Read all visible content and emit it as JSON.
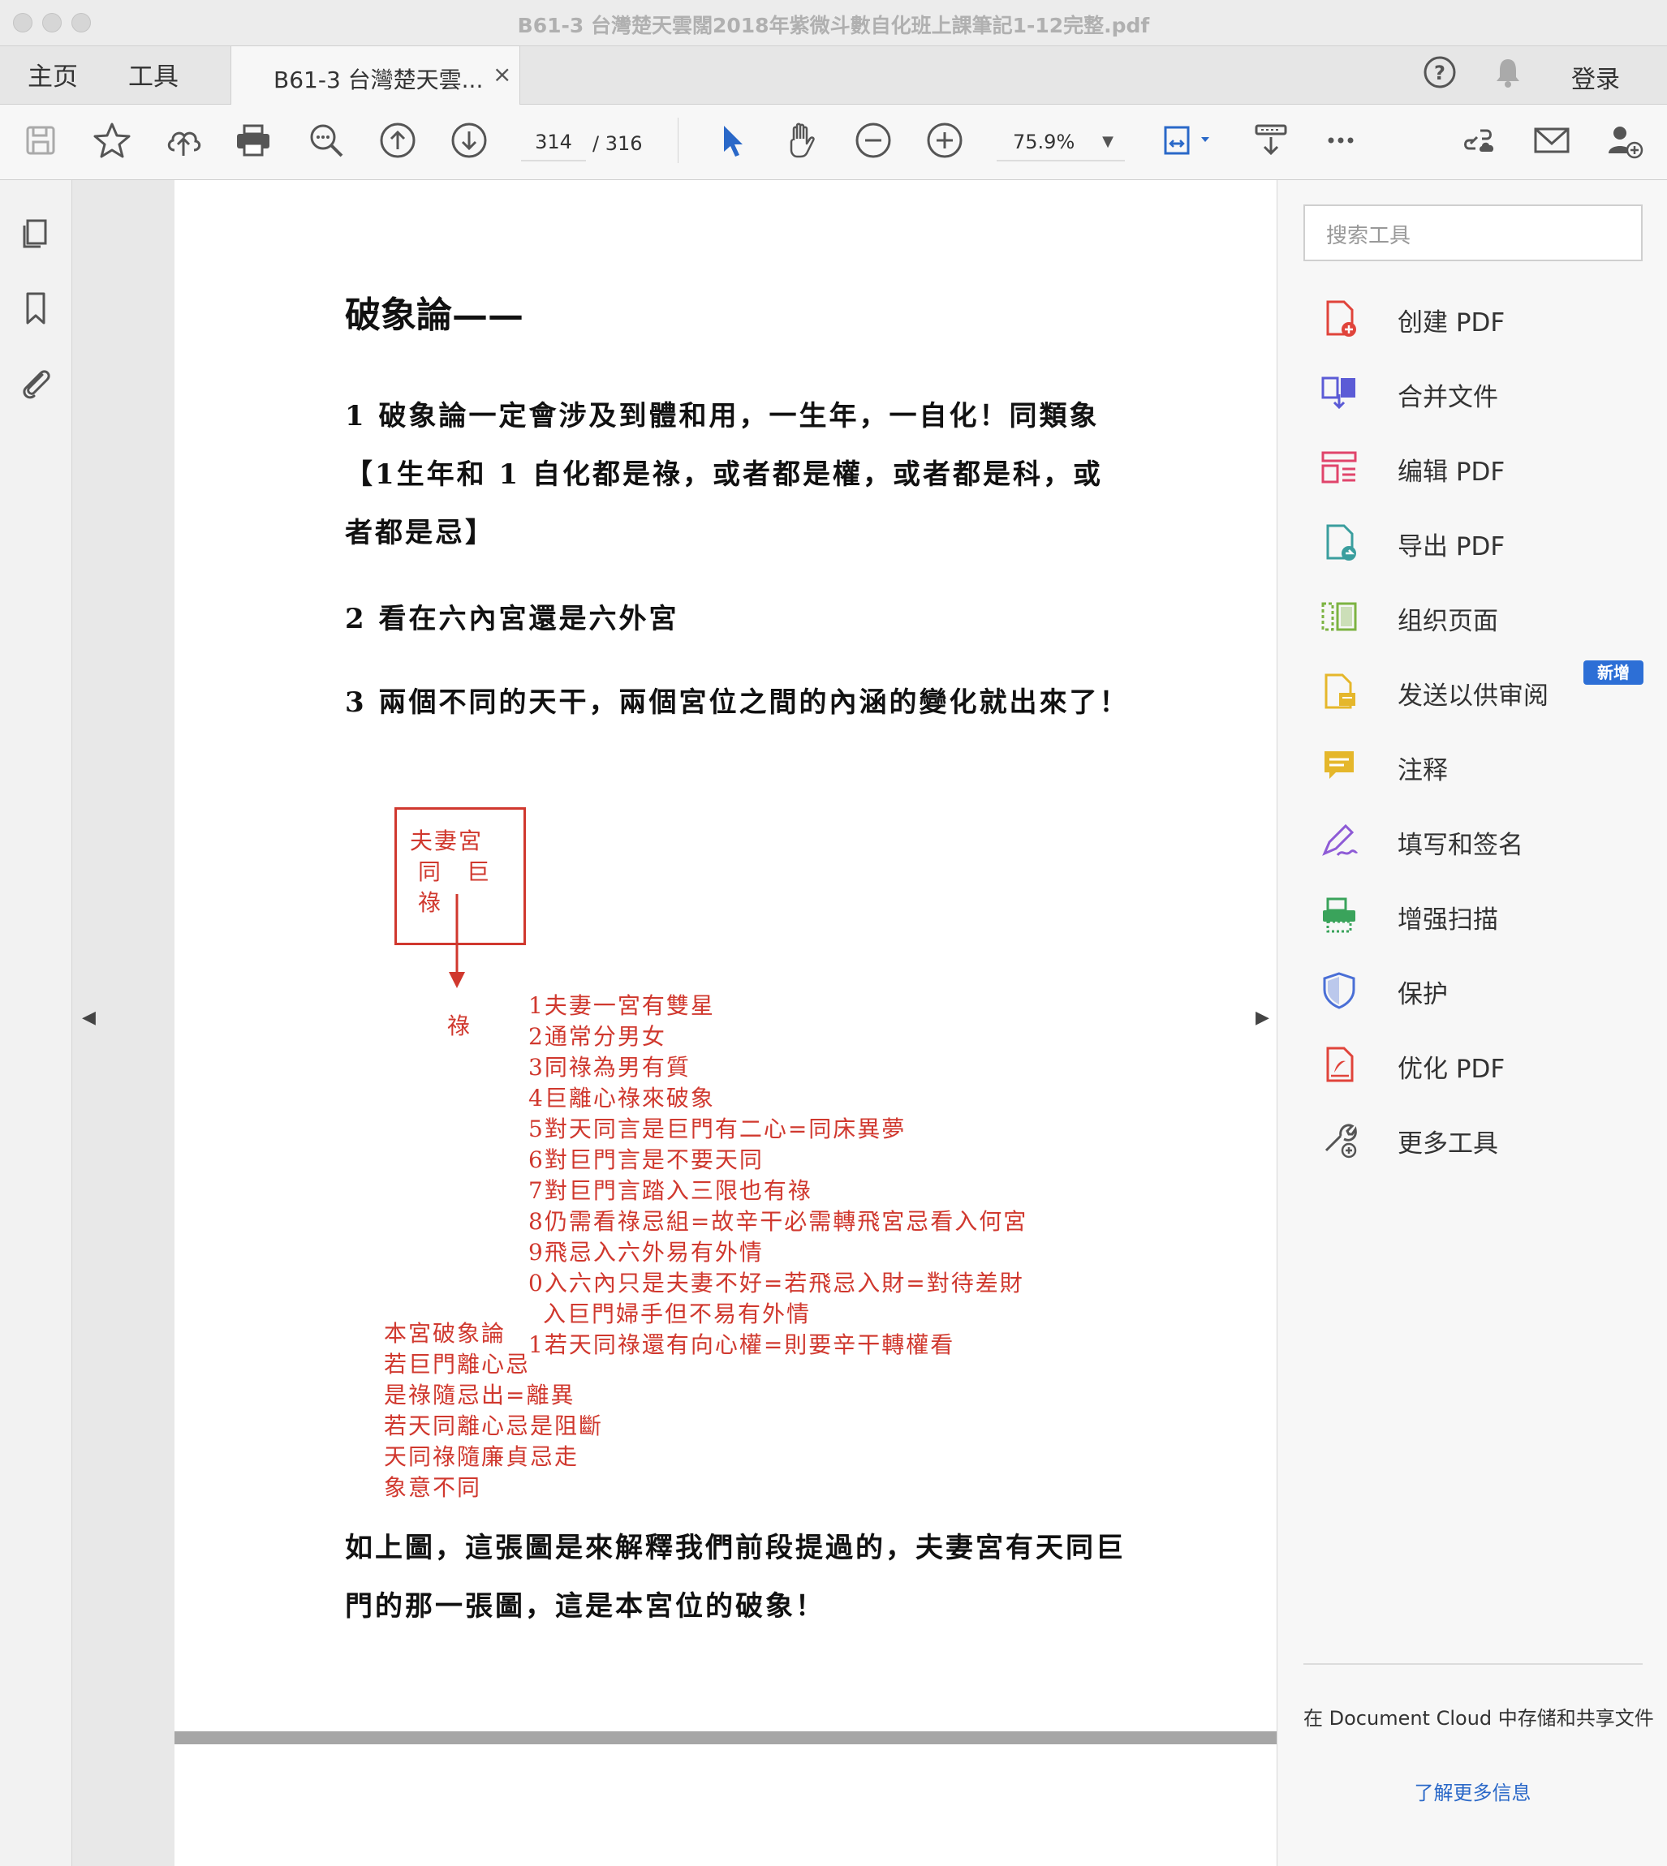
{
  "window": {
    "title": "B61-3 台灣楚天雲闊2018年紫微斗數自化班上課筆記1-12完整.pdf"
  },
  "tabs": {
    "home": "主页",
    "tools": "工具",
    "document": "B61-3 台灣楚天雲...",
    "close": "×",
    "login": "登录"
  },
  "toolbar": {
    "current_page": "314",
    "total_pages": "/ 316",
    "zoom": "75.9%",
    "zoom_arrow": "▼"
  },
  "document": {
    "heading": "破象論——",
    "paragraphs": [
      "1 破象論一定會涉及到體和用，一生年，一自化！同類象【1生年和 1 自化都是祿，或者都是權，或者都是科，或者都是忌】",
      "2 看在六內宮還是六外宮",
      "3 兩個不同的天干，兩個宮位之間的內涵的變化就出來了！"
    ],
    "diagram": {
      "box_lines": [
        "夫妻宮",
        "同　巨",
        "祿"
      ],
      "arrow_target": "祿",
      "notes": [
        "1夫妻一宮有雙星",
        "2通常分男女",
        "3同祿為男有質",
        "4巨離心祿來破象",
        "5對天同言是巨門有二心=同床異夢",
        "6對巨門言是不要天同",
        "7對巨門言踏入三限也有祿",
        "8仍需看祿忌組=故辛干必需轉飛宮忌看入何宮",
        "9飛忌入六外易有外情",
        "0入六內只是夫妻不好=若飛忌入財=對待差財",
        "入巨門婦手但不易有外情",
        "1若天同祿還有向心權=則要辛干轉權看"
      ],
      "bottom_notes": [
        "本宮破象論",
        "若巨門離心忌",
        "是祿隨忌出=離異",
        "若天同離心忌是阻斷",
        "天同祿隨廉貞忌走",
        "象意不同"
      ]
    },
    "closing": "如上圖，這張圖是來解釋我們前段提過的，夫妻宮有天同巨門的那一張圖，這是本宮位的破象！"
  },
  "right_panel": {
    "search_placeholder": "搜索工具",
    "tools": [
      {
        "label": "创建 PDF",
        "icon": "create-pdf-icon",
        "color": "#e0443b"
      },
      {
        "label": "合并文件",
        "icon": "combine-files-icon",
        "color": "#5b5bd6"
      },
      {
        "label": "编辑 PDF",
        "icon": "edit-pdf-icon",
        "color": "#e0446b"
      },
      {
        "label": "导出 PDF",
        "icon": "export-pdf-icon",
        "color": "#3a9e9e"
      },
      {
        "label": "组织页面",
        "icon": "organize-pages-icon",
        "color": "#7cb342"
      },
      {
        "label": "发送以供审阅",
        "icon": "send-review-icon",
        "color": "#e5b72b"
      },
      {
        "label": "注释",
        "icon": "comment-icon",
        "color": "#e5b72b"
      },
      {
        "label": "填写和签名",
        "icon": "fill-sign-icon",
        "color": "#8e5bd6"
      },
      {
        "label": "增强扫描",
        "icon": "enhance-scan-icon",
        "color": "#3aa35b"
      },
      {
        "label": "保护",
        "icon": "protect-icon",
        "color": "#4a6fd6"
      },
      {
        "label": "优化 PDF",
        "icon": "optimize-pdf-icon",
        "color": "#e0443b"
      },
      {
        "label": "更多工具",
        "icon": "more-tools-icon",
        "color": "#555555"
      }
    ],
    "new_badge": "新增",
    "cloud_text": "在 Document Cloud 中存储和共享文件",
    "learn_more": "了解更多信息"
  },
  "colors": {
    "accent_blue": "#2a68c8",
    "handwriting_red": "#d0382e"
  }
}
